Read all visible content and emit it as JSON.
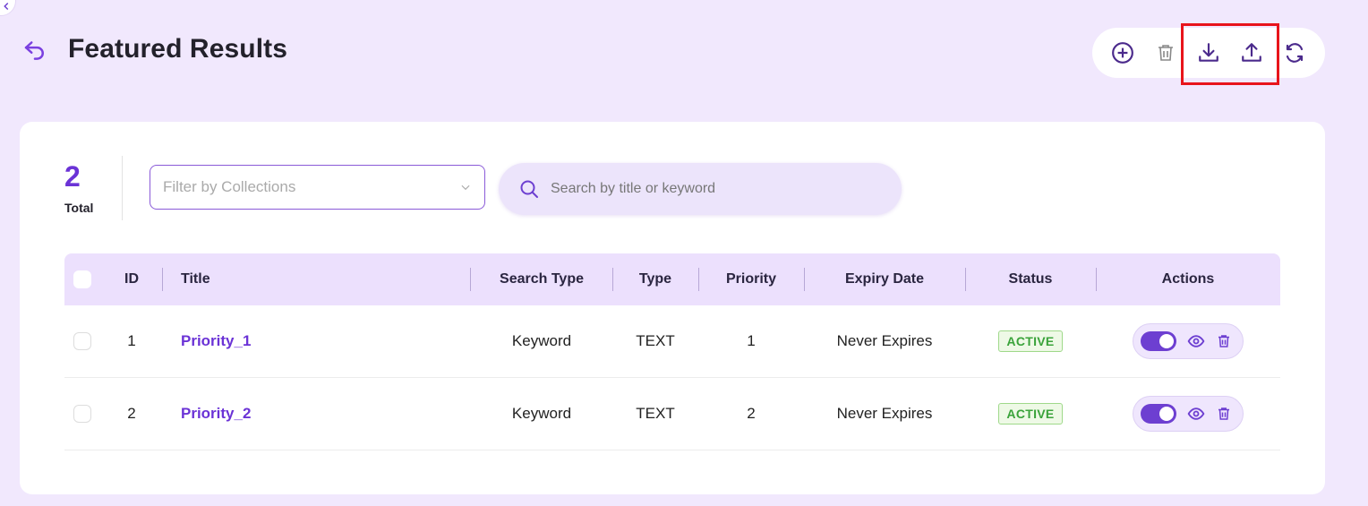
{
  "page": {
    "title": "Featured Results"
  },
  "icons": {
    "back": "undo-arrow-icon",
    "add": "plus-circle-icon",
    "delete": "trash-icon",
    "download": "download-icon",
    "upload": "upload-icon",
    "refresh": "refresh-icon",
    "search": "search-icon",
    "chevron": "chevron-down-icon",
    "view": "eye-icon"
  },
  "summary": {
    "count": "2",
    "label": "Total"
  },
  "filter": {
    "placeholder": "Filter by Collections"
  },
  "search": {
    "placeholder": "Search by title or keyword"
  },
  "table": {
    "columns": [
      "ID",
      "Title",
      "Search Type",
      "Type",
      "Priority",
      "Expiry Date",
      "Status",
      "Actions"
    ],
    "rows": [
      {
        "id": "1",
        "title": "Priority_1",
        "search_type": "Keyword",
        "type": "TEXT",
        "priority": "1",
        "expiry": "Never Expires",
        "status": "ACTIVE",
        "enabled": true
      },
      {
        "id": "2",
        "title": "Priority_2",
        "search_type": "Keyword",
        "type": "TEXT",
        "priority": "2",
        "expiry": "Never Expires",
        "status": "ACTIVE",
        "enabled": true
      }
    ]
  },
  "colors": {
    "accent": "#6d3fd1",
    "background": "#f1e8fd",
    "header_row": "#ece0fd",
    "active_badge": "#3aa33a",
    "highlight": "#e8141b"
  }
}
